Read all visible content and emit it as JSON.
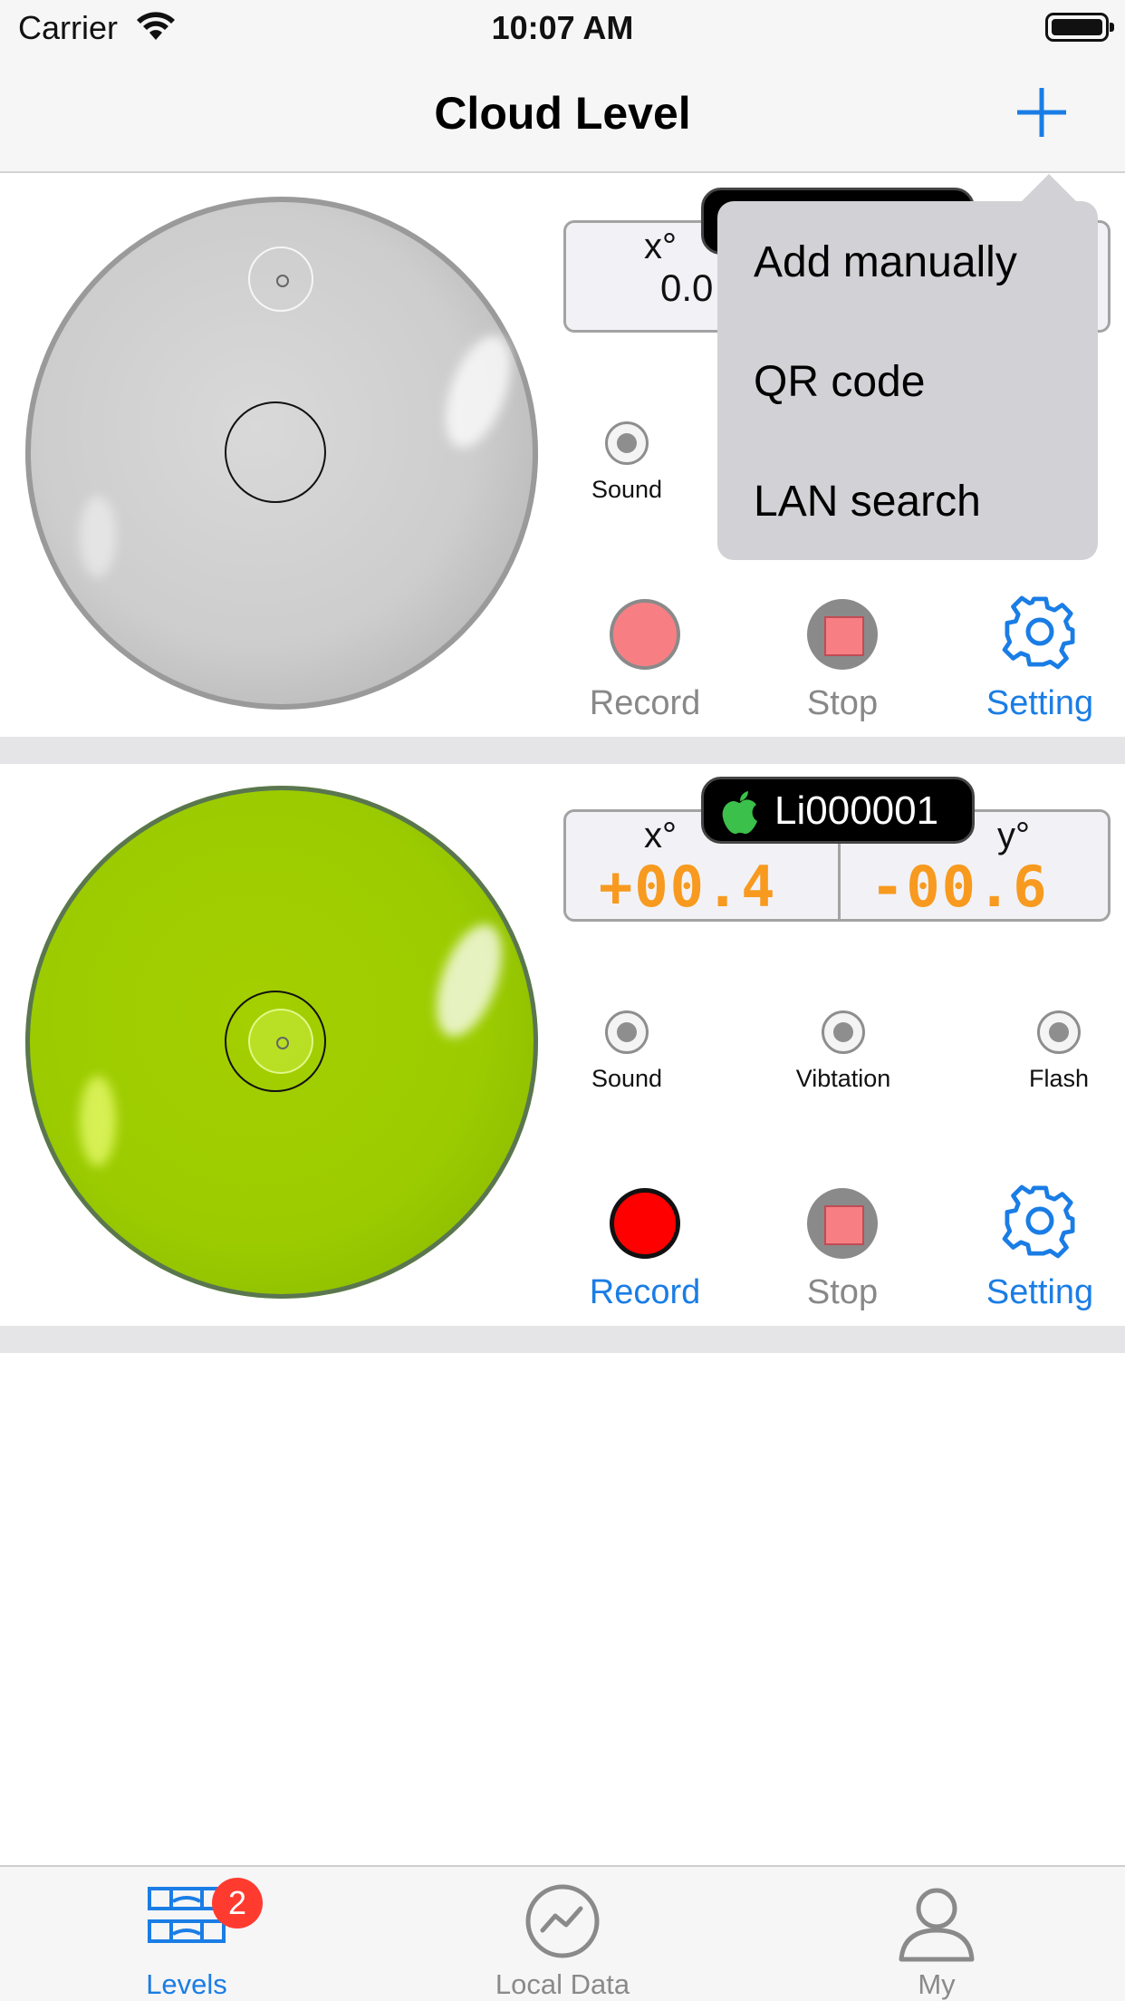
{
  "status_bar": {
    "carrier": "Carrier",
    "time": "10:07 AM"
  },
  "nav": {
    "title": "Cloud Level",
    "add_icon": "plus-icon"
  },
  "menu": {
    "items": [
      "Add manually",
      "QR code",
      "LAN search"
    ]
  },
  "levels": [
    {
      "x_label": "x°",
      "x_value": "0.0",
      "toggles": [
        "Sound"
      ],
      "actions": {
        "record": "Record",
        "stop": "Stop",
        "setting": "Setting"
      },
      "record_active": false,
      "vial_color": "#c8c8c8"
    },
    {
      "device": "Li000001",
      "x_label": "x°",
      "x_value": "+00.4",
      "y_label": "y°",
      "y_value": "-00.6",
      "toggles": [
        "Sound",
        "Vibtation",
        "Flash"
      ],
      "actions": {
        "record": "Record",
        "stop": "Stop",
        "setting": "Setting"
      },
      "record_active": true,
      "vial_color": "#9ccc00"
    }
  ],
  "tabbar": {
    "tabs": [
      {
        "label": "Levels",
        "icon": "level-icon",
        "active": true,
        "badge": "2"
      },
      {
        "label": "Local Data",
        "icon": "chart-icon",
        "active": false
      },
      {
        "label": "My",
        "icon": "person-icon",
        "active": false
      }
    ]
  },
  "colors": {
    "accent": "#1a7de5",
    "digit": "#f79a1f",
    "record_red": "#ff0000",
    "badge": "#ff3b30"
  }
}
